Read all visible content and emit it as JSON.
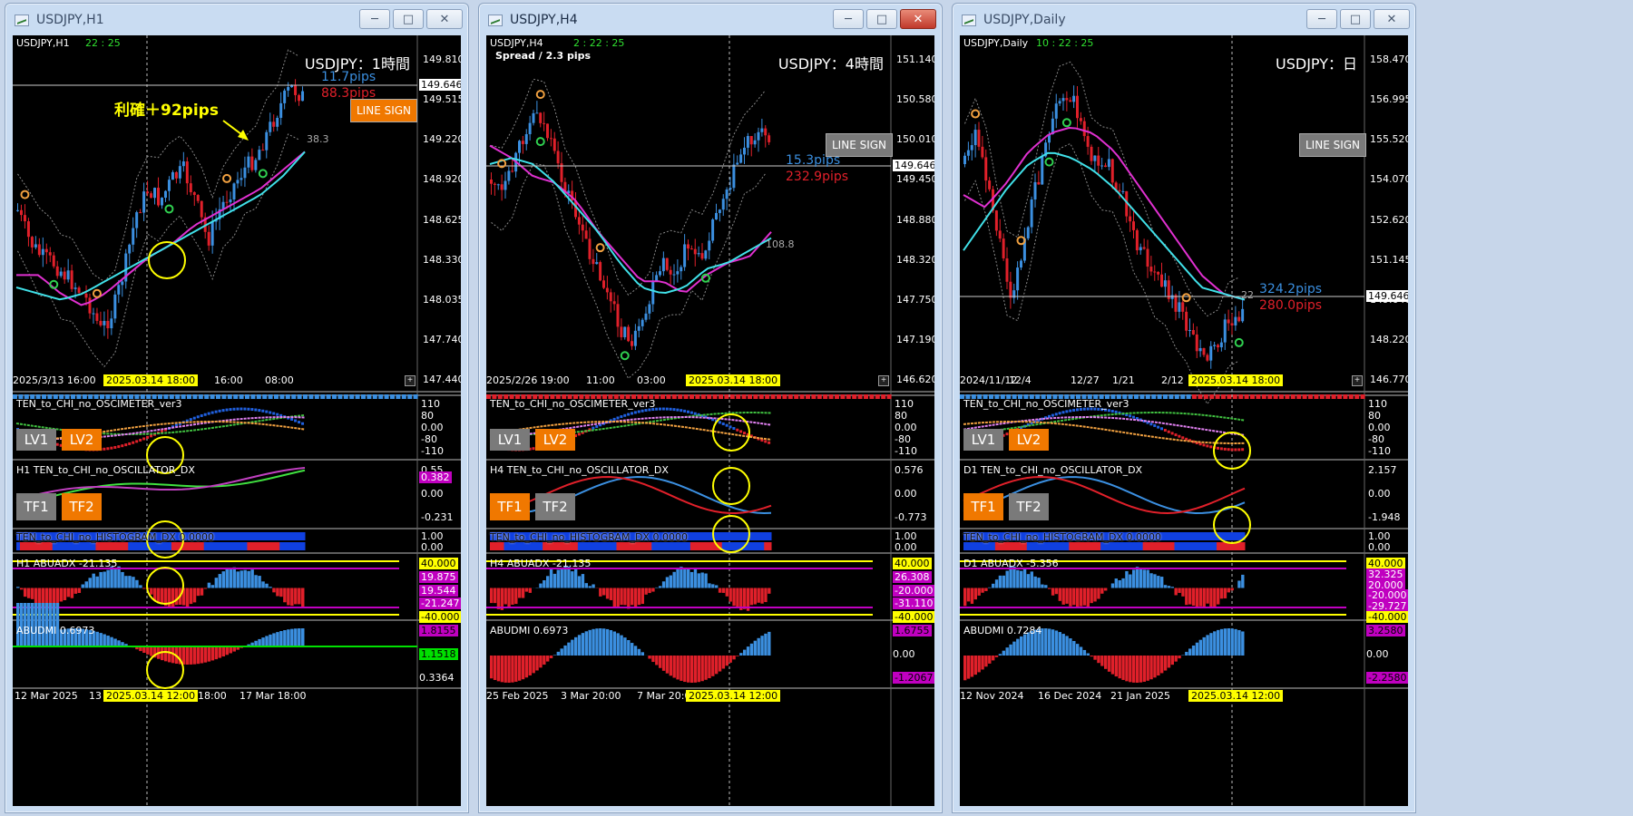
{
  "colors": {
    "bull": "#3b8fe0",
    "bear": "#e0202a",
    "ma_fast": "#40e0e8",
    "ma_slow": "#e030d0",
    "yellow_badge": "#ffff00",
    "orange_btn": "#f07800",
    "gray_btn": "#7a7a7a",
    "purple_tag": "#c000c0",
    "green_tag": "#00e000"
  },
  "windows": [
    {
      "id": "h1",
      "window_title": "USDJPY,H1",
      "symbol_label": "USDJPY,H1",
      "timer": "22 : 25",
      "big_title": "USDJPY：1時間",
      "pips_blue": "11.7pips",
      "pips_red": "88.3pips",
      "annotation": "利確＋92pips",
      "ma_value": "38.3",
      "line_sign": "LINE SIGN",
      "line_sign_style": "orange",
      "price_box": "149.646",
      "price_ticks": [
        "149.810",
        "149.515",
        "149.220",
        "148.920",
        "148.625",
        "148.330",
        "148.035",
        "147.740",
        "147.440"
      ],
      "time_ticks": [
        "2025/3/13 16:00",
        "16:00",
        "08:00"
      ],
      "date_badge": "2025.03.14 18:00",
      "osc_title": "TEN_to_CHI_no_OSCIMETER_ver3",
      "osc_ticks": [
        "110",
        "80",
        "0.00",
        "-80",
        "-110"
      ],
      "dx_title": "H1 TEN_to_CHI_no_OSCILLATOR_DX",
      "dx_ticks": [
        "0.55",
        "0.00",
        "-0.231"
      ],
      "dx_tag": "0.382",
      "hist_title": "TEN_to_CHI_no_HISTOGRAM_DX 0.0000",
      "hist_ticks": [
        "1.00",
        "0.00"
      ],
      "adx_title": "H1 ABUADX -21.135",
      "adx_tags": [
        "40.000",
        "19.875",
        "19.544",
        "-21.247",
        "-40.000"
      ],
      "abudmi_title": "ABUDMI  0.6973",
      "abudmi_ticks": [
        "1.8155",
        "1.1518",
        "0.3364"
      ],
      "bottom_ticks": [
        "12 Mar 2025",
        "13",
        "r 18:00",
        "17 Mar 18:00"
      ],
      "bottom_badge": "2025.03.14 12:00",
      "lv_buttons": [
        "LV1",
        "LV2"
      ],
      "tf_buttons": [
        "TF1",
        "TF2"
      ]
    },
    {
      "id": "h4",
      "window_title": "USDJPY,H4",
      "symbol_label": "USDJPY,H4",
      "timer": "2 : 22 : 25",
      "spread": "Spread / 2.3 pips",
      "big_title": "USDJPY：4時間",
      "pips_blue": "15.3pips",
      "pips_red": "232.9pips",
      "ma_value": "108.8",
      "line_sign": "LINE SIGN",
      "line_sign_style": "gray",
      "price_box": "149.646",
      "price_ticks": [
        "151.140",
        "150.580",
        "150.010",
        "149.450",
        "148.880",
        "148.320",
        "147.750",
        "147.190",
        "146.620"
      ],
      "time_ticks": [
        "2025/2/26 19:00",
        "11:00",
        "03:00"
      ],
      "date_badge": "2025.03.14 18:00",
      "osc_title": "TEN_to_CHI_no_OSCIMETER_ver3",
      "osc_ticks": [
        "110",
        "80",
        "0.00",
        "-80",
        "-110"
      ],
      "dx_title": "H4 TEN_to_CHI_no_OSCILLATOR_DX",
      "dx_ticks": [
        "0.576",
        "0.00",
        "-0.773"
      ],
      "hist_title": "TEN_to_CHI_no_HISTOGRAM_DX 0.0000",
      "hist_ticks": [
        "1.00",
        "0.00"
      ],
      "adx_title": "H4 ABUADX -21.135",
      "adx_tags": [
        "40.000",
        "26.308",
        "-20.000",
        "-31.110",
        "-40.000"
      ],
      "abudmi_title": "ABUDMI  0.6973",
      "abudmi_ticks": [
        "1.6755",
        "0.00",
        "-1.2067"
      ],
      "bottom_ticks": [
        "25 Feb 2025",
        "3 Mar 20:00",
        "7 Mar 20:00"
      ],
      "bottom_badge": "2025.03.14 12:00",
      "lv_buttons": [
        "LV1",
        "LV2"
      ],
      "tf_buttons": [
        "TF1",
        "TF2"
      ]
    },
    {
      "id": "d1",
      "window_title": "USDJPY,Daily",
      "symbol_label": "USDJPY,Daily",
      "timer": "10 : 22 : 25",
      "big_title": "USDJPY：日",
      "pips_blue": "324.2pips",
      "pips_red": "280.0pips",
      "ma_value": "22",
      "line_sign": "LINE SIGN",
      "line_sign_style": "gray",
      "price_box": "149.646",
      "price_ticks": [
        "158.470",
        "156.995",
        "155.520",
        "154.070",
        "152.620",
        "151.145",
        "149.646",
        "148.220",
        "146.770"
      ],
      "time_ticks": [
        "2024/11/12",
        "12/4",
        "12/27",
        "1/21",
        "2/12"
      ],
      "date_badge": "2025.03.14 18:00",
      "osc_title": "TEN_to_CHI_no_OSCIMETER_ver3",
      "osc_ticks": [
        "110",
        "80",
        "0.00",
        "-80",
        "-110"
      ],
      "dx_title": "D1 TEN_to_CHI_no_OSCILLATOR_DX",
      "dx_ticks": [
        "2.157",
        "0.00",
        "-1.948"
      ],
      "hist_title": "TEN_to_CHI_no_HISTOGRAM_DX 0.0000",
      "hist_ticks": [
        "1.00",
        "0.00"
      ],
      "adx_title": "D1 ABUADX -5.356",
      "adx_tags": [
        "40.000",
        "32.325",
        "20.000",
        "-20.000",
        "-29.727",
        "-40.000"
      ],
      "abudmi_title": "ABUDMI  0.7284",
      "abudmi_ticks": [
        "3.2580",
        "0.00",
        "-2.2580"
      ],
      "bottom_ticks": [
        "12 Nov 2024",
        "16 Dec 2024",
        "21 Jan 2025"
      ],
      "bottom_badge": "2025.03.14 12:00",
      "lv_buttons": [
        "LV1",
        "LV2"
      ],
      "tf_buttons": [
        "TF1",
        "TF2"
      ]
    }
  ]
}
